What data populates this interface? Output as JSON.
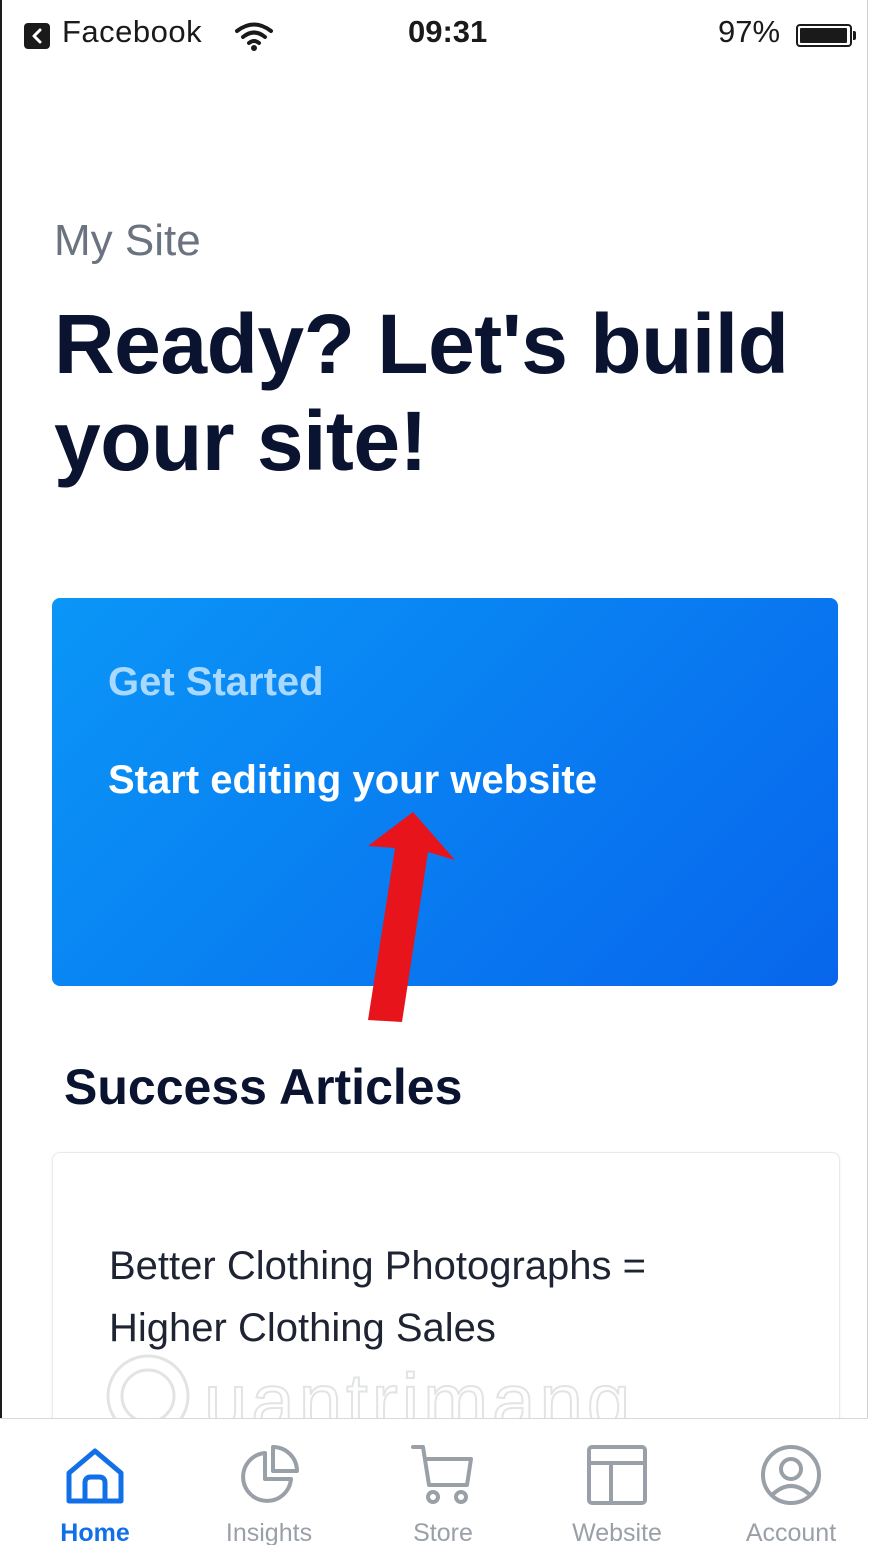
{
  "status_bar": {
    "back_app": "Facebook",
    "time": "09:31",
    "battery_percent": "97%",
    "battery_level": 0.97
  },
  "header": {
    "site_label": "My Site",
    "title": "Ready? Let's build your site!"
  },
  "get_started_card": {
    "eyebrow": "Get Started",
    "link_text": "Start editing your website",
    "gradient_start": "#0a96f7",
    "gradient_end": "#0866ec"
  },
  "annotation": {
    "color": "#e8141c",
    "icon": "red-arrow-up"
  },
  "success_articles": {
    "title": "Success Articles",
    "articles": [
      {
        "title": "Better Clothing Photographs = Higher Clothing Sales"
      }
    ]
  },
  "watermark": {
    "text": "Quantrimang"
  },
  "tab_bar": {
    "active_color": "#1170e8",
    "inactive_color": "#9aa0a8",
    "tabs": [
      {
        "label": "Home",
        "icon": "home-icon",
        "active": true
      },
      {
        "label": "Insights",
        "icon": "pie-chart-icon",
        "active": false
      },
      {
        "label": "Store",
        "icon": "cart-icon",
        "active": false
      },
      {
        "label": "Website",
        "icon": "layout-icon",
        "active": false
      },
      {
        "label": "Account",
        "icon": "user-circle-icon",
        "active": false
      }
    ]
  }
}
